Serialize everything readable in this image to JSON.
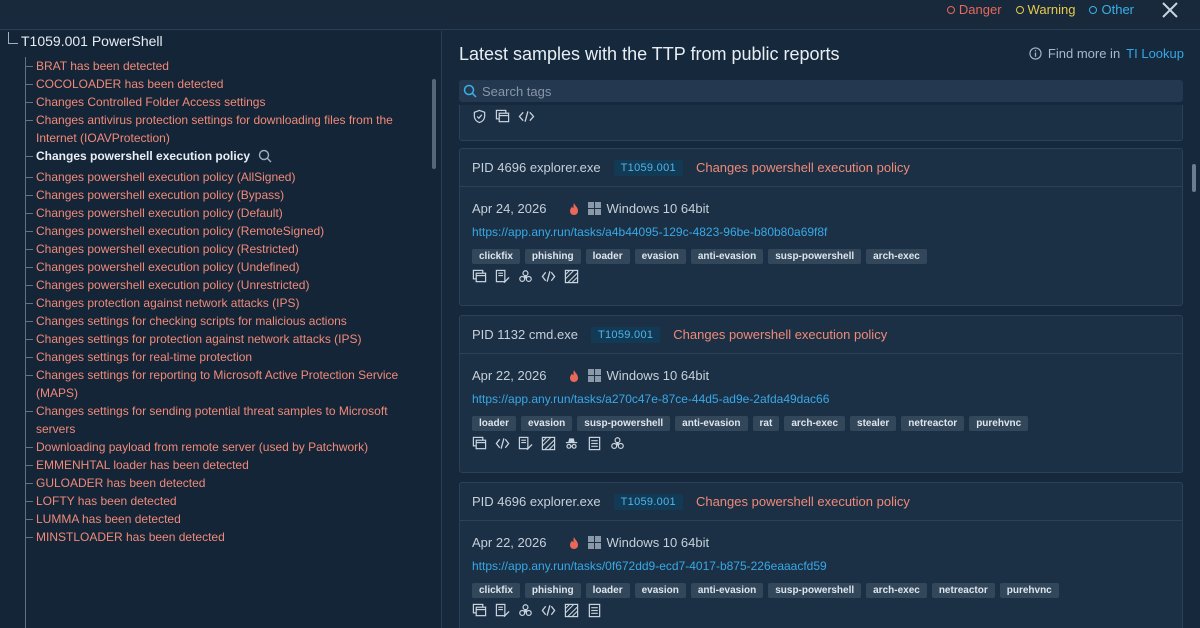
{
  "legend": [
    {
      "label": "Danger",
      "color": "#e8685a"
    },
    {
      "label": "Warning",
      "color": "#e8c94a"
    },
    {
      "label": "Other",
      "color": "#3ab0e8"
    }
  ],
  "tree": {
    "root_label": "T1059.001 PowerShell",
    "items": [
      "BRAT has been detected",
      "COCOLOADER has been detected",
      "Changes Controlled Folder Access settings",
      "Changes antivirus protection settings for downloading files from the Internet (IOAVProtection)",
      "Changes powershell execution policy",
      "Changes powershell execution policy (AllSigned)",
      "Changes powershell execution policy (Bypass)",
      "Changes powershell execution policy (Default)",
      "Changes powershell execution policy (RemoteSigned)",
      "Changes powershell execution policy (Restricted)",
      "Changes powershell execution policy (Undefined)",
      "Changes powershell execution policy (Unrestricted)",
      "Changes protection against network attacks (IPS)",
      "Changes settings for checking scripts for malicious actions",
      "Changes settings for protection against network attacks (IPS)",
      "Changes settings for real-time protection",
      "Changes settings for reporting to Microsoft Active Protection Service (MAPS)",
      "Changes settings for sending potential threat samples to Microsoft servers",
      "Downloading payload from remote server (used by Patchwork)",
      "EMMENHTAL loader has been detected",
      "GULOADER has been detected",
      "LOFTY has been detected",
      "LUMMA has been detected",
      "MINSTLOADER has been detected"
    ],
    "active_index": 4
  },
  "panel": {
    "title": "Latest samples with the TTP from public reports",
    "find_more_prefix": "Find more in",
    "find_more_link": "TI Lookup",
    "search_placeholder": "Search tags"
  },
  "cards": [
    {
      "pid": "PID 4696 explorer.exe",
      "ttp": "T1059.001",
      "signature": "Changes powershell execution policy",
      "date": "Apr 24, 2026",
      "os": "Windows 10 64bit",
      "url": "https://app.any.run/tasks/a4b44095-129c-4823-96be-b80b80a69f8f",
      "tags": [
        "clickfix",
        "phishing",
        "loader",
        "evasion",
        "anti-evasion",
        "susp-powershell",
        "arch-exec"
      ],
      "icons": [
        "windows-icon",
        "script-edit-icon",
        "biohazard-icon",
        "code-icon",
        "pattern-icon"
      ]
    },
    {
      "pid": "PID 1132 cmd.exe",
      "ttp": "T1059.001",
      "signature": "Changes powershell execution policy",
      "date": "Apr 22, 2026",
      "os": "Windows 10 64bit",
      "url": "https://app.any.run/tasks/a270c47e-87ce-44d5-ad9e-2afda49dac66",
      "tags": [
        "loader",
        "evasion",
        "susp-powershell",
        "anti-evasion",
        "rat",
        "arch-exec",
        "stealer",
        "netreactor",
        "purehvnc"
      ],
      "icons": [
        "windows-icon",
        "code-icon",
        "script-edit-icon",
        "pattern-icon",
        "spy-icon",
        "document-icon",
        "biohazard-icon"
      ]
    },
    {
      "pid": "PID 4696 explorer.exe",
      "ttp": "T1059.001",
      "signature": "Changes powershell execution policy",
      "date": "Apr 22, 2026",
      "os": "Windows 10 64bit",
      "url": "https://app.any.run/tasks/0f672dd9-ecd7-4017-b875-226eaaacfd59",
      "tags": [
        "clickfix",
        "phishing",
        "loader",
        "evasion",
        "anti-evasion",
        "susp-powershell",
        "arch-exec",
        "netreactor",
        "purehvnc"
      ],
      "icons": [
        "windows-icon",
        "script-edit-icon",
        "biohazard-icon",
        "code-icon",
        "pattern-icon",
        "document-icon"
      ]
    }
  ]
}
